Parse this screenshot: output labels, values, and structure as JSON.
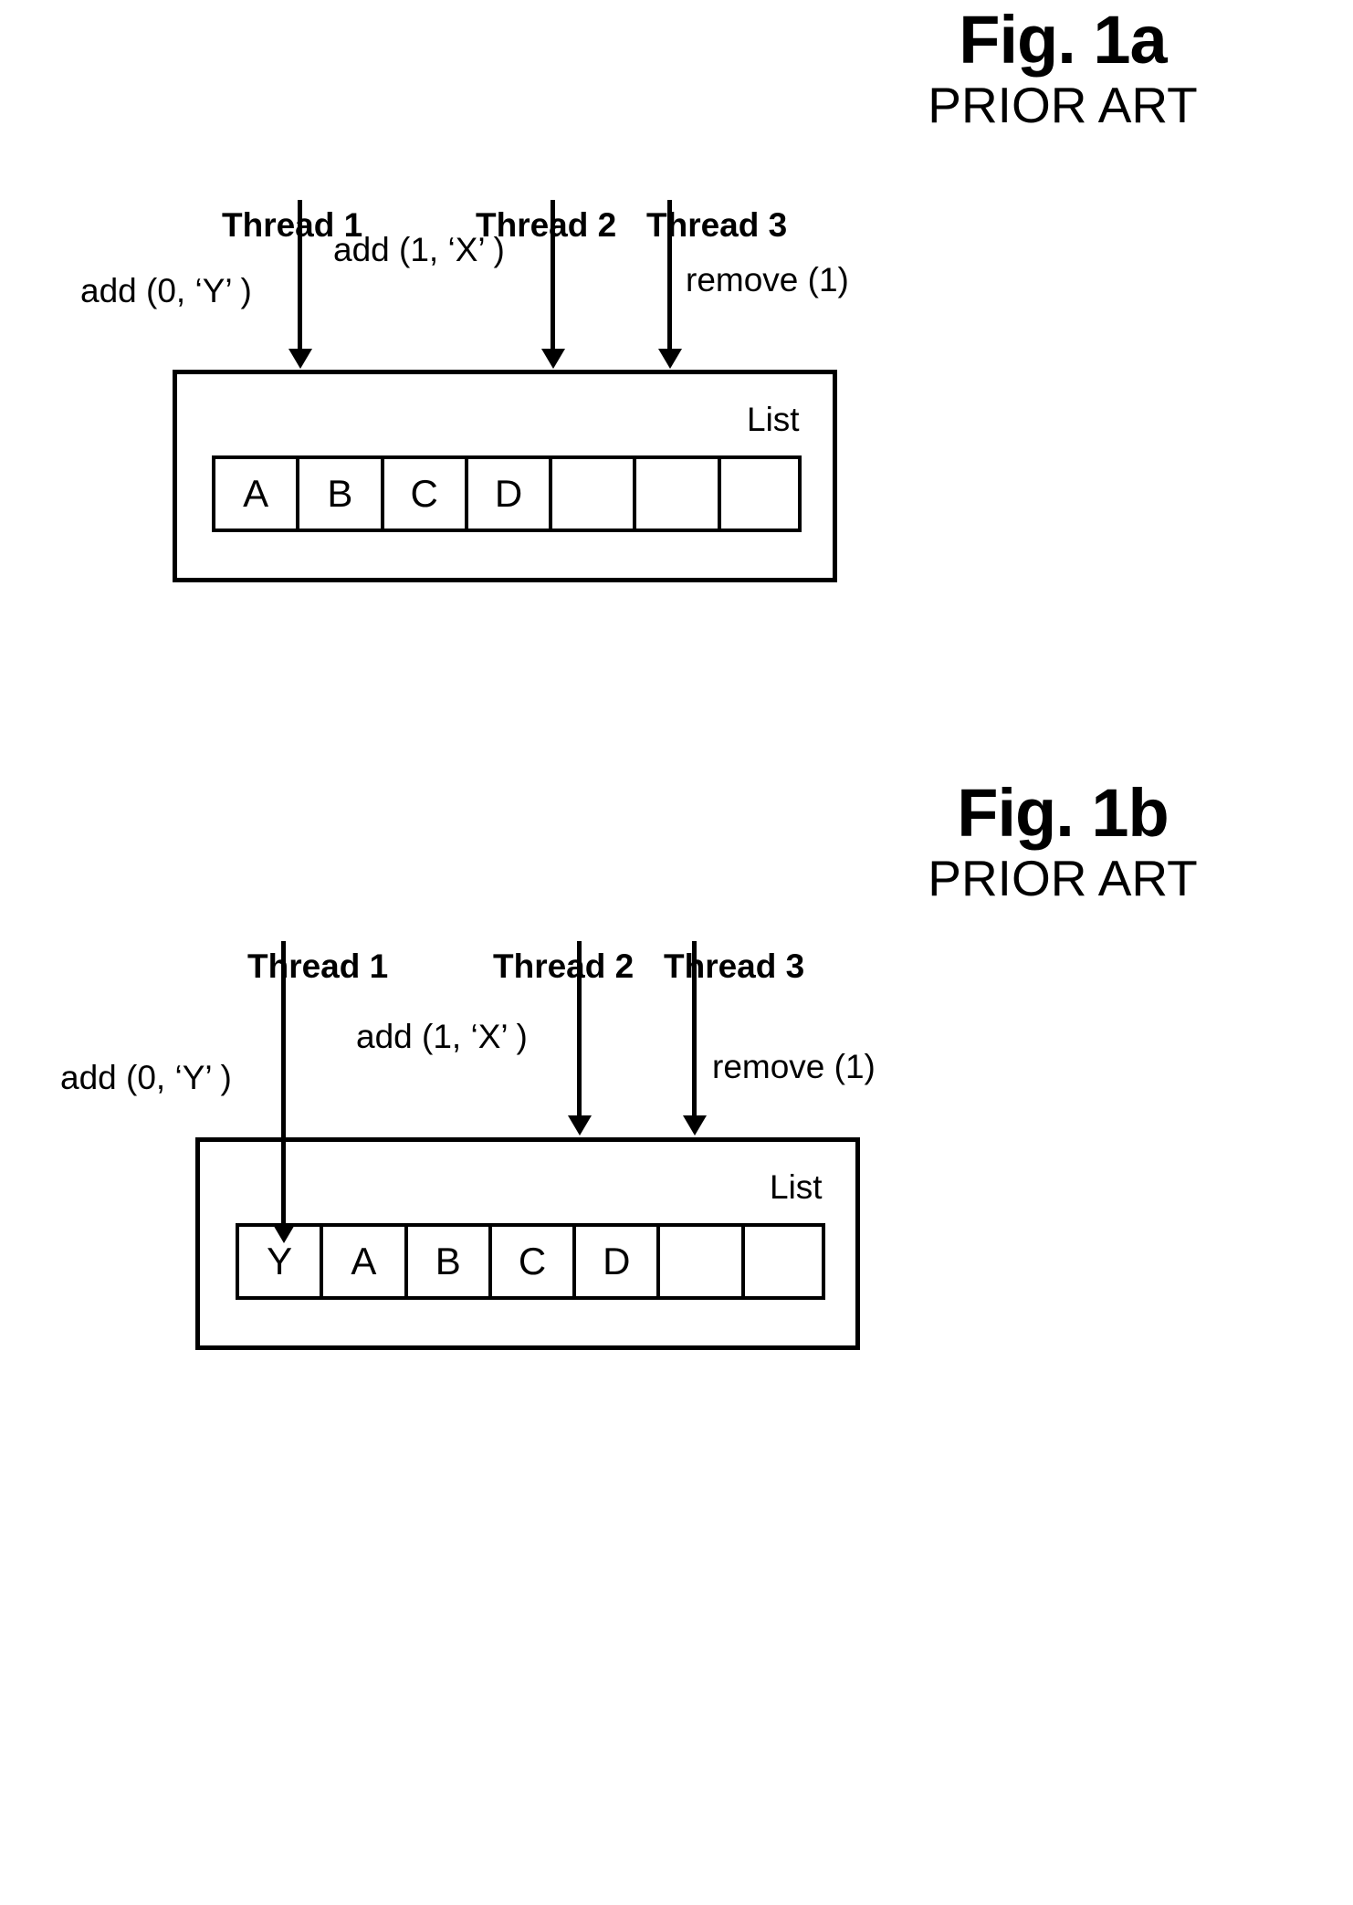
{
  "figures": [
    {
      "id": "fig-1a",
      "title": "Fig. 1a",
      "subtitle": "PRIOR ART",
      "threads": [
        {
          "label": "Thread 1"
        },
        {
          "label": "Thread 2"
        },
        {
          "label": "Thread 3"
        }
      ],
      "operations": [
        {
          "label": "add (0,   ‘Y’  )"
        },
        {
          "label": "add (1,   ‘X’  )"
        },
        {
          "label": "remove (1)"
        }
      ],
      "list_label": "List",
      "cells": [
        "A",
        "B",
        "C",
        "D",
        "",
        "",
        ""
      ]
    },
    {
      "id": "fig-1b",
      "title": "Fig. 1b",
      "subtitle": "PRIOR ART",
      "threads": [
        {
          "label": "Thread 1"
        },
        {
          "label": "Thread 2"
        },
        {
          "label": "Thread 3"
        }
      ],
      "operations": [
        {
          "label": "add (0,   ‘Y’  )"
        },
        {
          "label": "add (1,   ‘X’  )"
        },
        {
          "label": "remove (1)"
        }
      ],
      "list_label": "List",
      "cells": [
        "Y",
        "A",
        "B",
        "C",
        "D",
        "",
        ""
      ]
    }
  ],
  "colors": {
    "ink": "#000000",
    "paper": "#ffffff"
  }
}
